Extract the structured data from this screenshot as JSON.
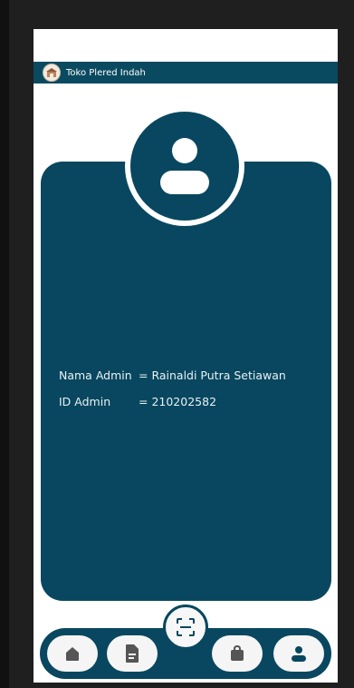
{
  "app": {
    "title": "Toko Plered Indah"
  },
  "profile": {
    "name_label": "Nama Admin",
    "name_value": "= Rainaldi Putra Setiawan",
    "id_label": "ID Admin",
    "id_value": "= 210202582"
  },
  "nav": {
    "items": [
      "home-icon",
      "document-icon",
      "scan-icon",
      "bag-icon",
      "user-icon"
    ]
  },
  "colors": {
    "primary": "#08475f",
    "background": "#ffffff",
    "nav_button": "#f5f5f5"
  }
}
